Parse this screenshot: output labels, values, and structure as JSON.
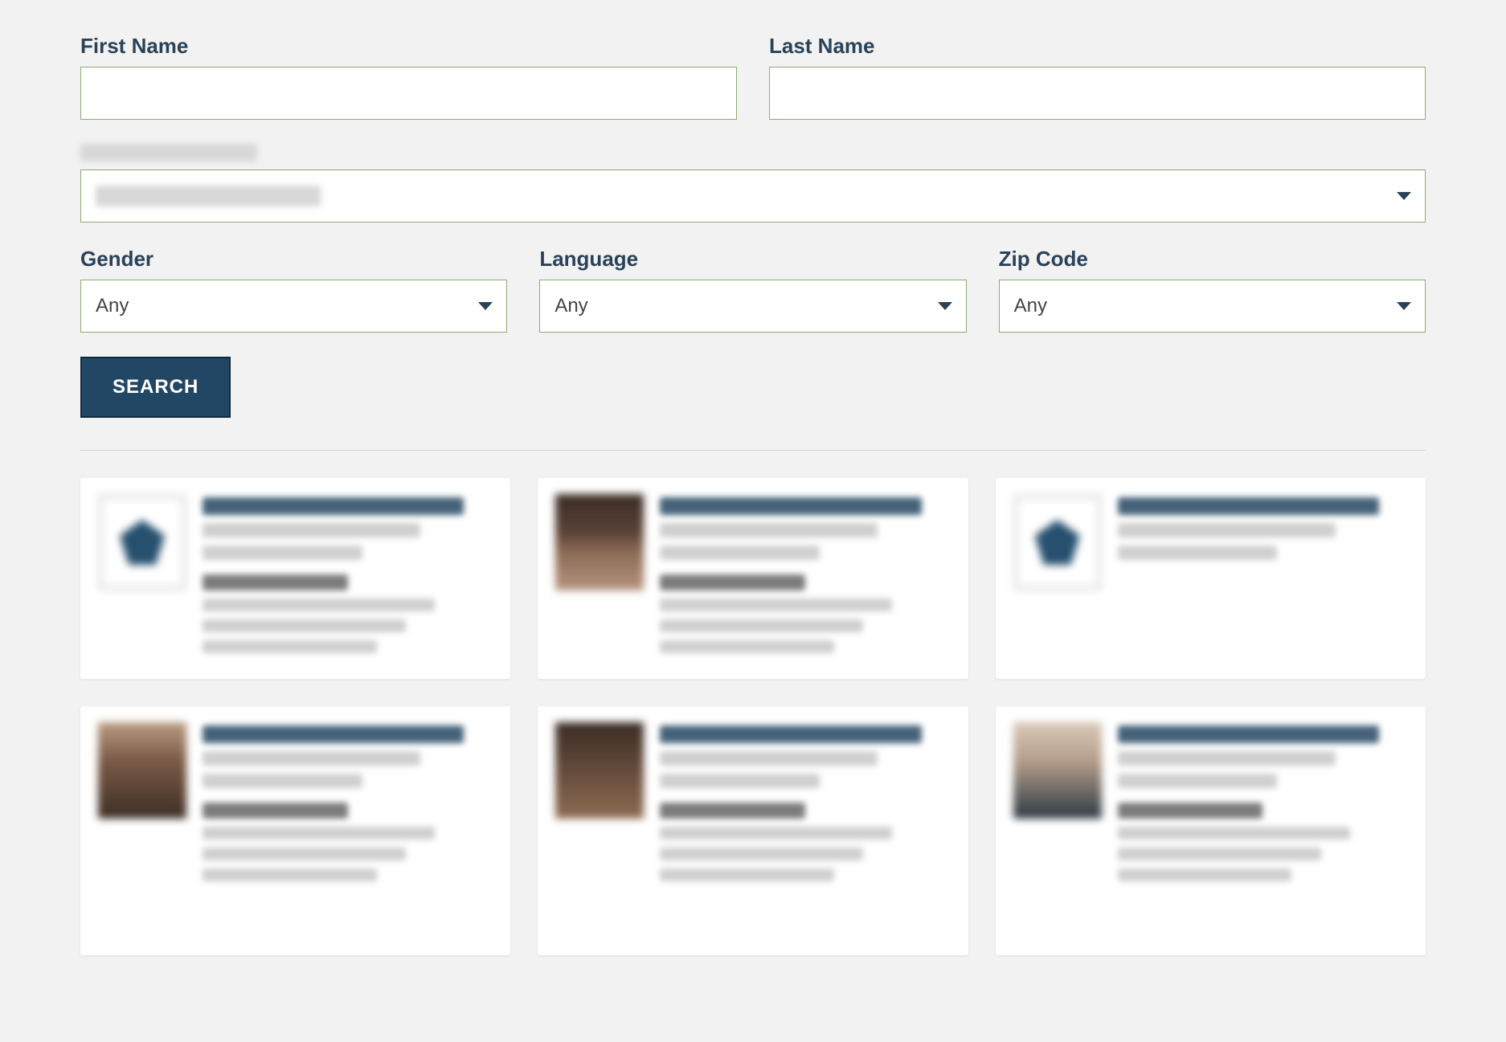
{
  "form": {
    "first_name": {
      "label": "First Name",
      "value": ""
    },
    "last_name": {
      "label": "Last Name",
      "value": ""
    },
    "category": {
      "label": "[redacted]",
      "value": "[redacted]"
    },
    "gender": {
      "label": "Gender",
      "value": "Any"
    },
    "language": {
      "label": "Language",
      "value": "Any"
    },
    "zipcode": {
      "label": "Zip Code",
      "value": "Any"
    },
    "search_label": "SEARCH"
  },
  "results": [
    {
      "avatar": "logo",
      "height": "short"
    },
    {
      "avatar": "person1",
      "height": "short"
    },
    {
      "avatar": "logo",
      "height": "short"
    },
    {
      "avatar": "person2",
      "height": "tall"
    },
    {
      "avatar": "person3",
      "height": "tall"
    },
    {
      "avatar": "person4",
      "height": "tall"
    }
  ],
  "colors": {
    "background": "#f2f2f2",
    "label_text": "#2a4258",
    "input_border": "#8dab72",
    "button_bg": "#224764",
    "button_border": "#0f2a3d"
  }
}
